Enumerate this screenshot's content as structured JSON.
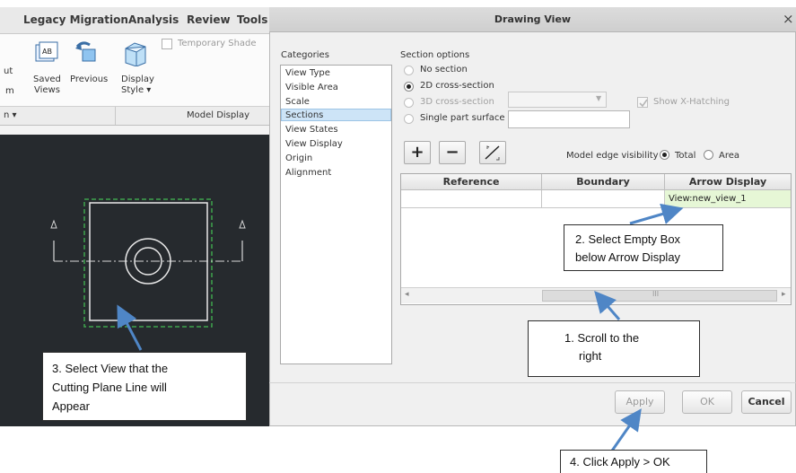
{
  "ribbon": {
    "tabs": [
      "Legacy Migration",
      "Analysis",
      "Review",
      "Tools"
    ],
    "temporary_shade": "Temporary Shade",
    "ut": "ut",
    "saved_views": "Saved\nViews",
    "saved": "Saved",
    "views": "Views",
    "previous": "Previous",
    "m_label": "m",
    "display": "Display",
    "style": "Style ▾",
    "group_left": "n ▾",
    "group_model_display": "Model Display"
  },
  "dialog": {
    "title": "Drawing View",
    "close": "×",
    "categories_header": "Categories",
    "categories": [
      "View Type",
      "Visible Area",
      "Scale",
      "Sections",
      "View States",
      "View Display",
      "Origin",
      "Alignment"
    ],
    "selected_category": "Sections",
    "section_options_header": "Section options",
    "options": {
      "no_section": "No section",
      "cross_2d": "2D cross-section",
      "cross_3d": "3D cross-section",
      "single_part": "Single part surface"
    },
    "show_hatching": "Show X-Hatching",
    "model_edge_visibility": "Model edge visibility",
    "edge_total": "Total",
    "edge_area": "Area",
    "table": {
      "headers": [
        "Reference",
        "Boundary",
        "Arrow Display"
      ],
      "arrow_display_value": "View:new_view_1"
    },
    "scroll_marker": "III",
    "buttons": {
      "apply": "Apply",
      "ok": "OK",
      "cancel": "Cancel"
    }
  },
  "callouts": {
    "c1_line1": "1.    Scroll to the",
    "c1_line2": "right",
    "c2_line1": "2. Select Empty Box",
    "c2_line2": "below Arrow Display",
    "c3_line1": "3. Select View that the",
    "c3_line2": "Cutting Plane Line will",
    "c3_line3": "Appear",
    "c4": "4. Click Apply > OK"
  },
  "colors": {
    "canvas_bg": "#262a2e",
    "selection": "#cde4f7",
    "arrow_display_cell": "#e6f7d6",
    "callout_arrow": "#4f86c6",
    "view_border": "#3fa34d"
  }
}
